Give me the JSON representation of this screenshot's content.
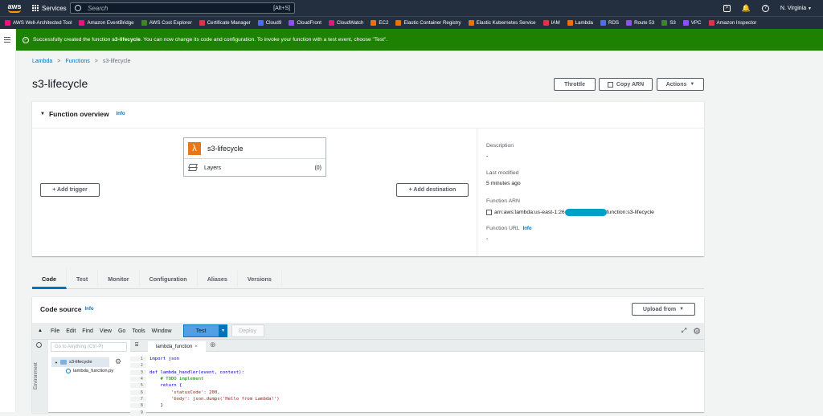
{
  "topbar": {
    "logo": "aws",
    "services_label": "Services",
    "search_placeholder": "Search",
    "search_shortcut": "[Alt+S]",
    "region": "N. Virginia",
    "region_caret": "▼"
  },
  "bookmarks": [
    {
      "label": "AWS Well-Architected Tool",
      "color": "#e7157b"
    },
    {
      "label": "Amazon EventBridge",
      "color": "#e7157b"
    },
    {
      "label": "AWS Cost Explorer",
      "color": "#3f8624"
    },
    {
      "label": "Certificate Manager",
      "color": "#dd344c"
    },
    {
      "label": "Cloud9",
      "color": "#4d6bfe"
    },
    {
      "label": "CloudFront",
      "color": "#8c4fff"
    },
    {
      "label": "CloudWatch",
      "color": "#e7157b"
    },
    {
      "label": "EC2",
      "color": "#ed7100"
    },
    {
      "label": "Elastic Container Registry",
      "color": "#ed7100"
    },
    {
      "label": "Elastic Kubernetes Service",
      "color": "#ed7100"
    },
    {
      "label": "IAM",
      "color": "#dd344c"
    },
    {
      "label": "Lambda",
      "color": "#ed7100"
    },
    {
      "label": "RDS",
      "color": "#4d6bfe"
    },
    {
      "label": "Route 53",
      "color": "#8c4fff"
    },
    {
      "label": "S3",
      "color": "#3f8624"
    },
    {
      "label": "VPC",
      "color": "#8c4fff"
    },
    {
      "label": "Amazon Inspector",
      "color": "#dd344c"
    }
  ],
  "flash": {
    "prefix": "Successfully created the function ",
    "function_name": "s3-lifecycle",
    "suffix": ". You can now change its code and configuration. To invoke your function with a test event, choose \"Test\"."
  },
  "breadcrumb": {
    "items": [
      "Lambda",
      "Functions",
      "s3-lifecycle"
    ],
    "separator": ">"
  },
  "page_title": "s3-lifecycle",
  "header_buttons": {
    "throttle": "Throttle",
    "copy_arn": "Copy ARN",
    "actions": "Actions"
  },
  "overview": {
    "title": "Function overview",
    "info": "Info",
    "function_name": "s3-lifecycle",
    "layers_label": "Layers",
    "layers_count": "(0)",
    "add_trigger": "+ Add trigger",
    "add_destination": "+ Add destination",
    "description_label": "Description",
    "description_value": "-",
    "last_modified_label": "Last modified",
    "last_modified_value": "5 minutes ago",
    "arn_label": "Function ARN",
    "arn_prefix": "arn:aws:lambda:us-east-1:26",
    "arn_suffix": "function:s3-lifecycle",
    "url_label": "Function URL",
    "url_info": "Info",
    "url_value": "-"
  },
  "tabs": [
    "Code",
    "Test",
    "Monitor",
    "Configuration",
    "Aliases",
    "Versions"
  ],
  "code_source": {
    "title": "Code source",
    "info": "Info",
    "upload_label": "Upload from",
    "menu": [
      "File",
      "Edit",
      "Find",
      "View",
      "Go",
      "Tools",
      "Window"
    ],
    "test_label": "Test",
    "deploy_label": "Deploy",
    "goto_placeholder": "Go to Anything (Ctrl-P)",
    "environment_label": "Environment",
    "tree_folder": "s3-lifecycle",
    "tree_file": "lambda_function.py",
    "editor_tab": "lambda_function",
    "editor_tab_close": "×",
    "code_lines": [
      {
        "n": "1",
        "text": "import json"
      },
      {
        "n": "2",
        "text": ""
      },
      {
        "n": "3",
        "text": "def lambda_handler(event, context):"
      },
      {
        "n": "4",
        "text": "    # TODO implement"
      },
      {
        "n": "5",
        "text": "    return {"
      },
      {
        "n": "6",
        "text": "        'statusCode': 200,"
      },
      {
        "n": "7",
        "text": "        'body': json.dumps('Hello from Lambda!')"
      },
      {
        "n": "8",
        "text": "    }"
      },
      {
        "n": "9",
        "text": ""
      }
    ]
  }
}
